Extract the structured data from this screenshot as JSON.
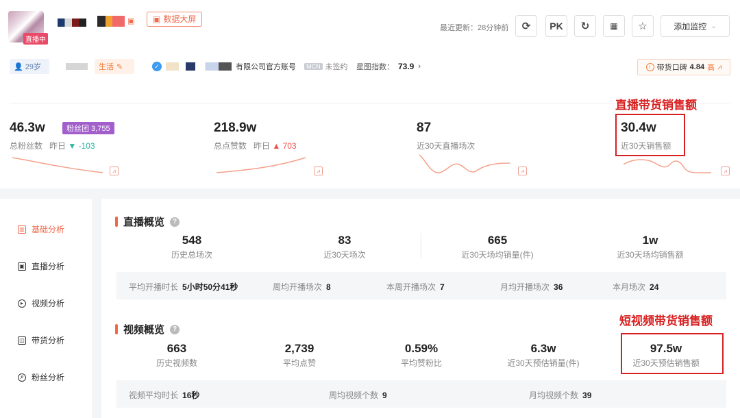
{
  "header": {
    "live_badge": "直播中",
    "big_screen_label": "数据大屏",
    "update_time": "最近更新：28分钟前",
    "pk_label": "PK",
    "monitor_label": "添加监控"
  },
  "profile": {
    "age": "29岁",
    "category": "生活",
    "account_type": "有限公司官方账号",
    "mcn_tag": "MCN",
    "mcn_status": "未签约",
    "star_index_label": "星图指数：",
    "star_index_value": "73.9",
    "reputation_label": "带货口碑",
    "reputation_value": "4.84",
    "reputation_level": "高"
  },
  "metrics": [
    {
      "value": "46.3w",
      "label": "总粉丝数",
      "delta_label": "昨日",
      "delta": "▼ -103",
      "badge": "粉丝团 3,755"
    },
    {
      "value": "218.9w",
      "label": "总点赞数",
      "delta_label": "昨日",
      "delta": "▲ 703"
    },
    {
      "value": "87",
      "label": "近30天直播场次"
    },
    {
      "value": "30.4w",
      "label": "近30天销售额"
    }
  ],
  "annotations": {
    "live_sales": "直播带货销售额",
    "video_sales": "短视频带货销售额"
  },
  "sidebar": {
    "items": [
      "基础分析",
      "直播分析",
      "视频分析",
      "带货分析",
      "粉丝分析"
    ]
  },
  "live_overview": {
    "title": "直播概览",
    "stats": [
      {
        "value": "548",
        "label": "历史总场次"
      },
      {
        "value": "83",
        "label": "近30天场次"
      },
      {
        "value": "665",
        "label": "近30天场均销量(件)"
      },
      {
        "value": "1w",
        "label": "近30天场均销售额"
      }
    ],
    "details": [
      {
        "label": "平均开播时长",
        "value": "5小时50分41秒"
      },
      {
        "label": "周均开播场次",
        "value": "8"
      },
      {
        "label": "本周开播场次",
        "value": "7"
      },
      {
        "label": "月均开播场次",
        "value": "36"
      },
      {
        "label": "本月场次",
        "value": "24"
      }
    ]
  },
  "video_overview": {
    "title": "视频概览",
    "stats": [
      {
        "value": "663",
        "label": "历史视频数"
      },
      {
        "value": "2,739",
        "label": "平均点赞"
      },
      {
        "value": "0.59%",
        "label": "平均赞粉比"
      },
      {
        "value": "6.3w",
        "label": "近30天预估销量(件)"
      },
      {
        "value": "97.5w",
        "label": "近30天预估销售额"
      }
    ],
    "details": [
      {
        "label": "视频平均时长",
        "value": "16秒"
      },
      {
        "label": "周均视频个数",
        "value": "9"
      },
      {
        "label": "月均视频个数",
        "value": "39"
      }
    ]
  },
  "colors": {
    "accent": "#f06a4a",
    "annotation": "#d92020",
    "fan_badge": "#a25fcc"
  }
}
